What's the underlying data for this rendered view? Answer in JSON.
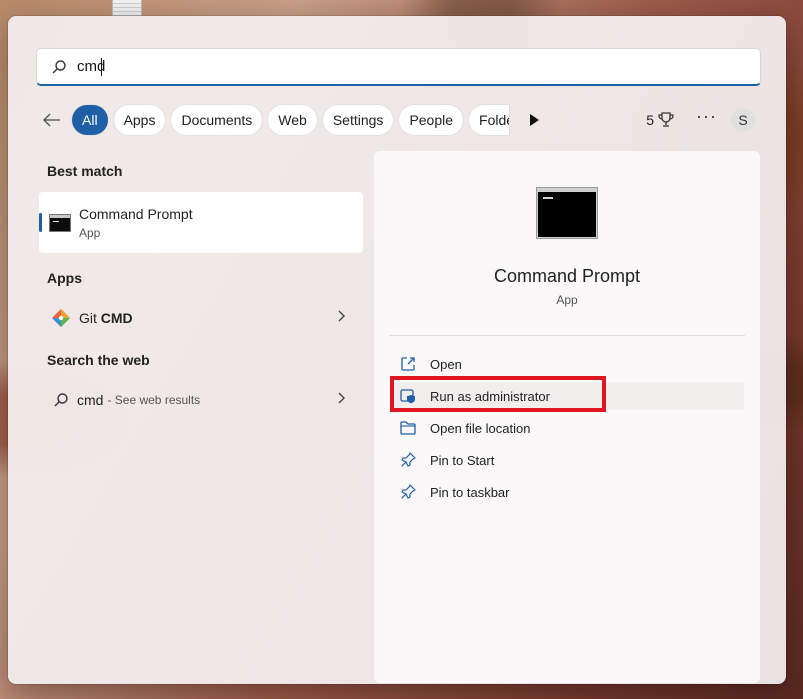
{
  "search": {
    "value": "cmd",
    "icon": "search-icon"
  },
  "filters": {
    "back_icon": "back-arrow-icon",
    "chips": [
      "All",
      "Apps",
      "Documents",
      "Web",
      "Settings",
      "People",
      "Folders"
    ],
    "play_icon": "play-icon",
    "points": "5",
    "points_icon": "trophy-icon",
    "more": "···",
    "avatar": "S"
  },
  "results": {
    "best_match_header": "Best match",
    "best_match": {
      "title": "Command Prompt",
      "subtitle": "App",
      "icon": "command-prompt-icon"
    },
    "apps_header": "Apps",
    "apps": [
      {
        "label_pre": "Git ",
        "label_bold": "CMD",
        "icon": "git-icon"
      }
    ],
    "web_header": "Search the web",
    "web": [
      {
        "query": "cmd",
        "suffix": "- See web results",
        "icon": "search-icon"
      }
    ]
  },
  "preview": {
    "title": "Command Prompt",
    "subtitle": "App",
    "actions": [
      {
        "label": "Open",
        "icon": "open-external-icon"
      },
      {
        "label": "Run as administrator",
        "icon": "shield-icon"
      },
      {
        "label": "Open file location",
        "icon": "folder-icon"
      },
      {
        "label": "Pin to Start",
        "icon": "pin-icon"
      },
      {
        "label": "Pin to taskbar",
        "icon": "pin-icon"
      }
    ]
  },
  "colors": {
    "accent": "#1f5fa6",
    "highlight": "#e0151f"
  }
}
